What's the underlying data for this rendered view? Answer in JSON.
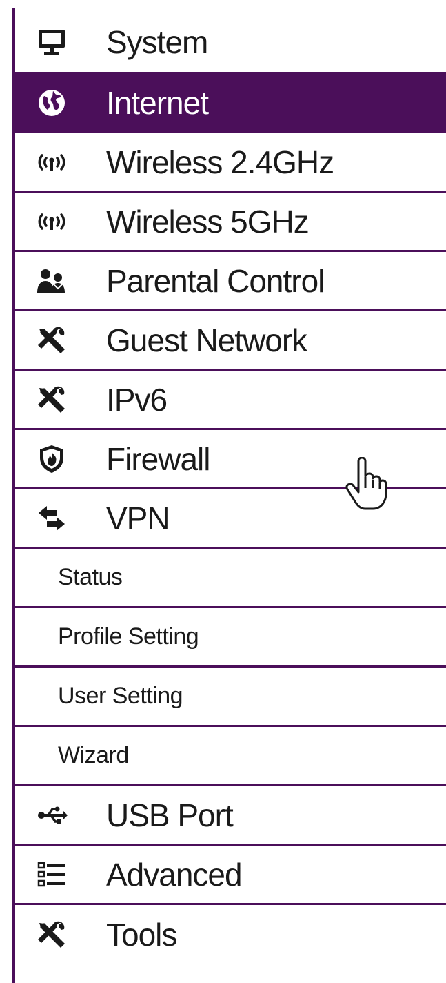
{
  "colors": {
    "accent": "#4b0f5a",
    "active_text": "#ffffff",
    "text": "#1a1a1a"
  },
  "menu": {
    "items": [
      {
        "label": "System",
        "icon": "monitor-icon",
        "active": false
      },
      {
        "label": "Internet",
        "icon": "globe-icon",
        "active": true
      },
      {
        "label": "Wireless 2.4GHz",
        "icon": "wireless-icon",
        "active": false
      },
      {
        "label": "Wireless 5GHz",
        "icon": "wireless-icon",
        "active": false
      },
      {
        "label": "Parental Control",
        "icon": "users-icon",
        "active": false
      },
      {
        "label": "Guest Network",
        "icon": "tools-icon",
        "active": false
      },
      {
        "label": "IPv6",
        "icon": "tools-icon",
        "active": false
      },
      {
        "label": "Firewall",
        "icon": "shield-fire-icon",
        "active": false
      },
      {
        "label": "VPN",
        "icon": "exchange-arrows-icon",
        "active": false
      },
      {
        "label": "Status",
        "sub": true
      },
      {
        "label": "Profile Setting",
        "sub": true
      },
      {
        "label": "User Setting",
        "sub": true
      },
      {
        "label": "Wizard",
        "sub": true
      },
      {
        "label": "USB Port",
        "icon": "usb-icon",
        "active": false
      },
      {
        "label": "Advanced",
        "icon": "list-icon",
        "active": false
      },
      {
        "label": "Tools",
        "icon": "tools-icon",
        "active": false
      }
    ]
  },
  "cursor": {
    "icon": "hand-pointer-icon"
  }
}
